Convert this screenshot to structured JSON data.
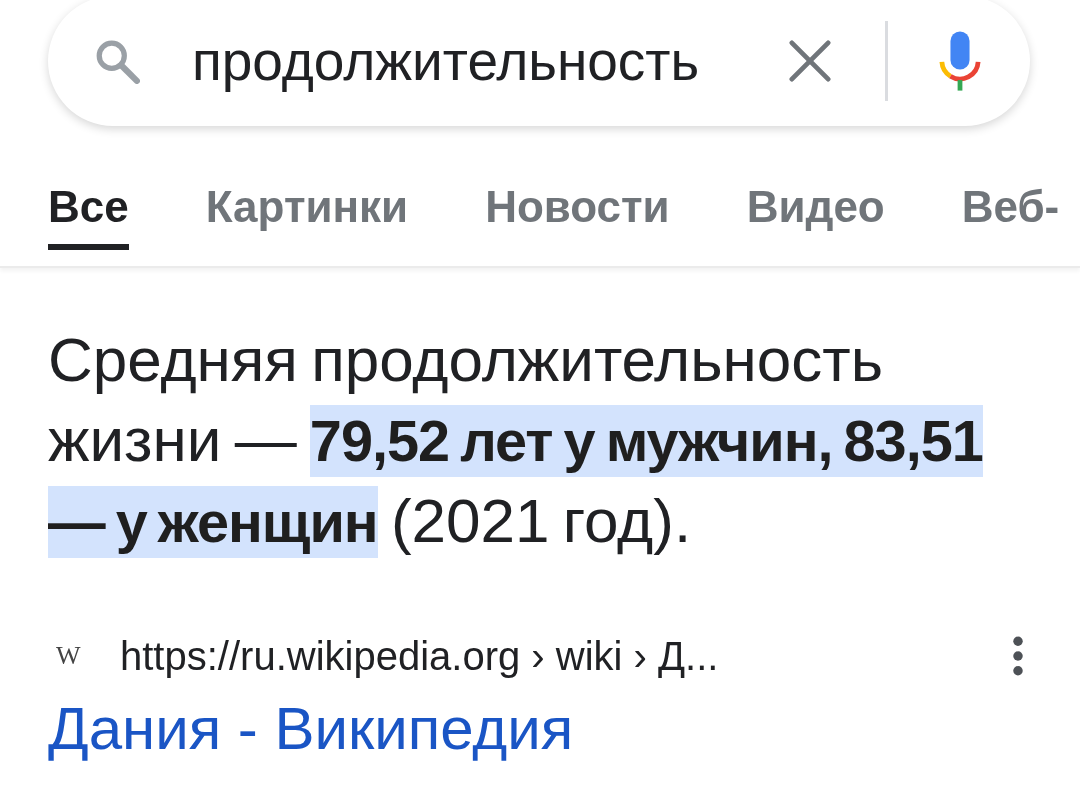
{
  "search": {
    "value": "продолжительность"
  },
  "tabs": [
    {
      "label": "Все",
      "selected": true
    },
    {
      "label": "Картинки",
      "selected": false
    },
    {
      "label": "Новости",
      "selected": false
    },
    {
      "label": "Видео",
      "selected": false
    },
    {
      "label": "Веб-",
      "selected": false
    }
  ],
  "answer": {
    "text": "Средняя продолжительность жизни — **79,52 лет у мужчин, 83,51 — у женщин** (2021 год)."
  },
  "result": {
    "favicon": "W",
    "url": "https://ru.wikipedia.org › wiki › Д...",
    "title": "Дания - Википедия"
  }
}
